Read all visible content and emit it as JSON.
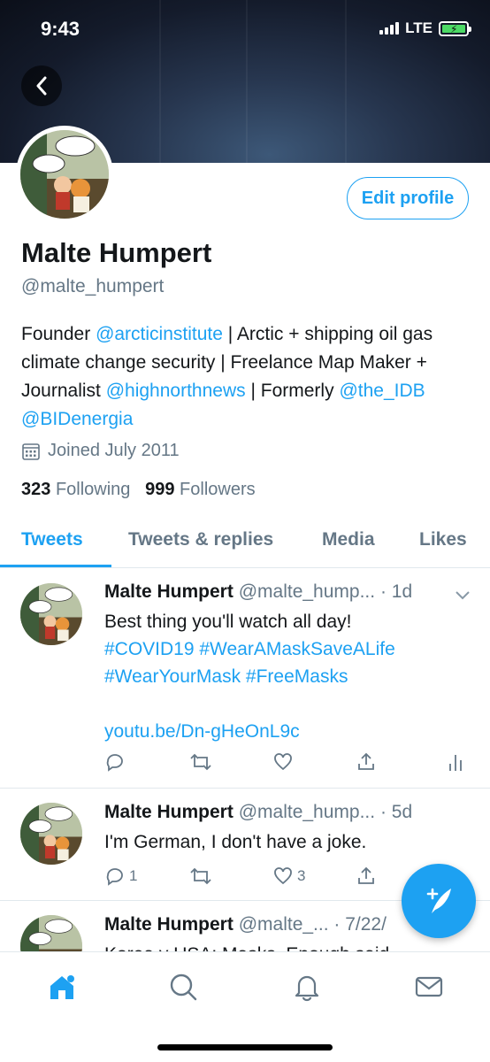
{
  "status_bar": {
    "time": "9:43",
    "network": "LTE"
  },
  "profile": {
    "name": "Malte Humpert",
    "handle": "@malte_humpert",
    "edit_button": "Edit profile",
    "bio": [
      {
        "text": "Founder ",
        "link": false
      },
      {
        "text": "@arcticinstitute",
        "link": true
      },
      {
        "text": " | Arctic + shipping oil gas climate change security | Freelance Map Maker + Journalist ",
        "link": false
      },
      {
        "text": "@highnorthnews",
        "link": true
      },
      {
        "text": " | Formerly ",
        "link": false
      },
      {
        "text": "@the_IDB",
        "link": true
      },
      {
        "text": " ",
        "link": false
      },
      {
        "text": "@BIDenergia",
        "link": true
      }
    ],
    "joined": "Joined July 2011",
    "following_count": "323",
    "following_label": "Following",
    "followers_count": "999",
    "followers_label": "Followers"
  },
  "tabs": [
    "Tweets",
    "Tweets & replies",
    "Media",
    "Likes"
  ],
  "tweets": [
    {
      "name": "Malte Humpert",
      "handle": "@malte_hump...",
      "time": "· 1d",
      "text": "Best thing you'll watch all day!",
      "hashtags": "#COVID19 #WearAMaskSaveALife #WearYourMask #FreeMasks",
      "link": "youtu.be/Dn-gHeOnL9c",
      "reply_count": "",
      "like_count": ""
    },
    {
      "name": "Malte Humpert",
      "handle": "@malte_hump...",
      "time": "· 5d",
      "text": "I'm German, I don't have a joke.",
      "reply_count": "1",
      "like_count": "3"
    },
    {
      "name": "Malte Humpert",
      "handle": "@malte_...",
      "time": "· 7/22/",
      "text": "Korea v USA: Masks. Enough said"
    }
  ],
  "nav": [
    "home-icon",
    "search-icon",
    "notifications-icon",
    "messages-icon"
  ],
  "colors": {
    "accent": "#1da1f2",
    "secondary_text": "#657786",
    "divider": "#e1e8ed"
  }
}
